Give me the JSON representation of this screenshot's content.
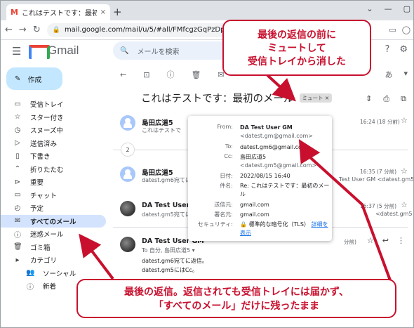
{
  "browser": {
    "tab_title": "これはテストです：最初のメール - da",
    "tab_close": "×",
    "new_tab": "+",
    "url": "mail.google.com/mail/u/5/#all/FMfcgzGqPzDpdjfzkvcjrsRTrZd",
    "win_min": "⌄",
    "win_sq": "—"
  },
  "gmail": {
    "logo_text": "Gmail",
    "search_placeholder": "メールを検索"
  },
  "sidebar": {
    "compose_label": "作成",
    "items": [
      {
        "label": "受信トレイ",
        "icon": "inbox-icon",
        "glyph": "▭"
      },
      {
        "label": "スター付き",
        "icon": "star-icon",
        "glyph": "☆"
      },
      {
        "label": "スヌーズ中",
        "icon": "clock-icon",
        "glyph": "◷"
      },
      {
        "label": "送信済み",
        "icon": "send-icon",
        "glyph": "▷"
      },
      {
        "label": "下書き",
        "icon": "draft-icon",
        "glyph": "▯"
      },
      {
        "label": "折りたたむ",
        "icon": "chevron-up-icon",
        "glyph": "⌃"
      },
      {
        "label": "重要",
        "icon": "important-icon",
        "glyph": "⊳"
      },
      {
        "label": "チャット",
        "icon": "chat-icon",
        "glyph": "▭"
      },
      {
        "label": "予定",
        "icon": "scheduled-icon",
        "glyph": "◴"
      },
      {
        "label": "すべてのメール",
        "icon": "all-mail-icon",
        "glyph": "✉"
      },
      {
        "label": "迷惑メール",
        "icon": "spam-icon",
        "glyph": "ⓘ"
      },
      {
        "label": "ゴミ箱",
        "icon": "trash-icon",
        "glyph": "🗑"
      },
      {
        "label": "カテゴリ",
        "icon": "category-icon",
        "glyph": "▸"
      },
      {
        "label": "ソーシャル",
        "icon": "social-icon",
        "glyph": "👥"
      },
      {
        "label": "新着",
        "icon": "updates-icon",
        "glyph": "ⓘ"
      }
    ]
  },
  "thread": {
    "subject": "これはテストです：最初のメール",
    "mute_chip": "ミュート ×",
    "lang": "あ"
  },
  "messages": [
    {
      "sender": "島田広道5",
      "preview": "これはテストで",
      "date": "16:24 (18 分前)"
    },
    {
      "collapsed_count": "2"
    },
    {
      "sender": "島田広道5",
      "preview": "datest.gm6宛てに",
      "preview2": "Test User GM <datest.gm5",
      "date": "16:35 (7 分前)"
    },
    {
      "sender": "DA Test User GM",
      "preview": "datest.gm5宛てに",
      "preview2": "<datest.gm5",
      "date": "16:37 (5 分前)"
    },
    {
      "sender": "DA Test User GM",
      "to_line": "To 自分, 島田広道5 ▾",
      "date": "分前)",
      "body1": "datest.gm6宛てに返信。",
      "body2": "datest.gm5にはCc。"
    }
  ],
  "popup": {
    "from_k": "From:",
    "from_name": "DA Test User GM",
    "from_addr": "<datest.gm@gmail.com>",
    "to_k": "To:",
    "to_v": "datest.gm6@gmail.com",
    "cc_k": "Cc:",
    "cc_name": "島田広道5",
    "cc_addr": "<datest.gm5@gmail.com>",
    "date_k": "日付:",
    "date_v": "2022/08/15 16:40",
    "subj_k": "件名:",
    "subj_v": "Re: これはテストです：最初のメール",
    "mailedby_k": "送信元:",
    "mailedby_v": "gmail.com",
    "signed_k": "署名元:",
    "signed_v": "gmail.com",
    "sec_k": "セキュリティ:",
    "sec_v": "🔒 標準的な暗号化（TLS）",
    "sec_link": "詳細を表示"
  },
  "callouts": {
    "top_l1": "最後の返信の前に",
    "top_l2": "ミュートして",
    "top_l3": "受信トレイから消した",
    "bot_l1": "最後の返信。返信されても受信トレイには届かず、",
    "bot_l2": "「すべてのメール」だけに残ったまま"
  },
  "colors": {
    "callout": "#c8102e",
    "active_nav": "#d3e3fd",
    "compose": "#c2e7ff"
  }
}
